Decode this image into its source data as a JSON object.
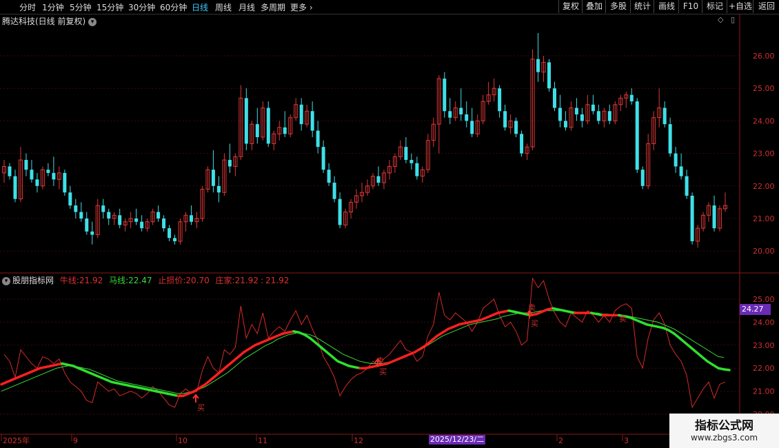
{
  "toolbar": {
    "timeframes": [
      "分时",
      "1分钟",
      "5分钟",
      "15分钟",
      "30分钟",
      "60分钟",
      "日线",
      "周线",
      "月线",
      "多周期",
      "更多"
    ],
    "active": "日线",
    "right_buttons": [
      "复权",
      "叠加",
      "多股",
      "统计",
      "画线",
      "F10",
      "标记",
      "+自选",
      "返回"
    ]
  },
  "chart_title": "腾达科技(日线 前复权)",
  "price_axis": [
    "26.00",
    "25.00",
    "24.00",
    "23.00",
    "22.00",
    "21.00",
    "20.00"
  ],
  "indicator": {
    "name": "股朋指标网",
    "niu_label": "牛线:",
    "niu_value": "21.92",
    "ma_label": "马线:",
    "ma_value": "22.47",
    "stop_label": "止损价:",
    "stop_value": "20.70",
    "zj_label": "庄家:",
    "zj_value": "21.92",
    "zj_value2": "21.92"
  },
  "ind_axis": [
    "25.00",
    "24.00",
    "23.00",
    "22.00",
    "21.00",
    "20.00"
  ],
  "current_badge": "24.27",
  "x_labels": [
    "2025年",
    "9",
    "10",
    "11",
    "12",
    "2",
    "3"
  ],
  "date_badge": "2025/12/23/二",
  "signals": {
    "buy": "买",
    "sell": "卖"
  },
  "watermark": {
    "title": "指标公式网",
    "url": "www.zbgs3.com"
  },
  "chart_data": {
    "type": "candlestick",
    "series": [
      {
        "name": "K线",
        "ohlc": [
          [
            22.4,
            22.8,
            22.1,
            22.6
          ],
          [
            22.6,
            22.7,
            22.2,
            22.3
          ],
          [
            22.3,
            22.5,
            21.5,
            21.6
          ],
          [
            21.6,
            23.2,
            21.5,
            22.8
          ],
          [
            22.8,
            23.0,
            22.3,
            22.5
          ],
          [
            22.5,
            22.8,
            22.1,
            22.2
          ],
          [
            22.2,
            22.4,
            21.8,
            22.0
          ],
          [
            22.0,
            22.6,
            21.9,
            22.5
          ],
          [
            22.5,
            22.7,
            22.3,
            22.4
          ],
          [
            22.4,
            22.9,
            22.0,
            22.2
          ],
          [
            22.2,
            22.6,
            21.9,
            22.4
          ],
          [
            22.4,
            22.5,
            21.7,
            21.8
          ],
          [
            21.8,
            22.0,
            21.3,
            21.4
          ],
          [
            21.4,
            21.6,
            21.0,
            21.2
          ],
          [
            21.2,
            21.5,
            20.9,
            21.0
          ],
          [
            21.0,
            21.2,
            20.5,
            20.6
          ],
          [
            20.6,
            20.9,
            20.2,
            20.5
          ],
          [
            20.5,
            21.6,
            20.4,
            21.4
          ],
          [
            21.4,
            21.6,
            21.0,
            21.2
          ],
          [
            21.2,
            21.3,
            20.8,
            21.0
          ],
          [
            21.0,
            21.2,
            20.8,
            21.1
          ],
          [
            21.1,
            21.3,
            20.7,
            20.8
          ],
          [
            20.8,
            21.0,
            20.6,
            20.9
          ],
          [
            20.9,
            21.2,
            20.7,
            21.0
          ],
          [
            21.0,
            21.3,
            20.8,
            20.9
          ],
          [
            20.9,
            21.1,
            20.6,
            20.7
          ],
          [
            20.7,
            21.0,
            20.6,
            20.9
          ],
          [
            20.9,
            21.3,
            20.8,
            21.2
          ],
          [
            21.2,
            21.4,
            20.9,
            21.0
          ],
          [
            21.0,
            21.1,
            20.6,
            20.7
          ],
          [
            20.7,
            20.8,
            20.3,
            20.4
          ],
          [
            20.4,
            20.5,
            20.2,
            20.3
          ],
          [
            20.3,
            21.0,
            20.2,
            20.9
          ],
          [
            20.9,
            21.2,
            20.6,
            21.1
          ],
          [
            21.1,
            21.4,
            20.8,
            20.9
          ],
          [
            20.9,
            21.2,
            20.7,
            21.0
          ],
          [
            21.0,
            22.0,
            20.9,
            21.9
          ],
          [
            21.9,
            22.6,
            21.8,
            22.5
          ],
          [
            22.5,
            23.1,
            21.8,
            22.0
          ],
          [
            22.0,
            22.3,
            21.5,
            21.8
          ],
          [
            21.8,
            23.0,
            21.7,
            22.8
          ],
          [
            22.8,
            23.3,
            22.4,
            22.6
          ],
          [
            22.6,
            23.0,
            22.3,
            22.9
          ],
          [
            22.9,
            25.1,
            22.8,
            24.7
          ],
          [
            24.7,
            25.0,
            23.1,
            23.3
          ],
          [
            23.3,
            24.0,
            23.1,
            23.9
          ],
          [
            23.9,
            24.4,
            23.3,
            23.5
          ],
          [
            23.5,
            24.6,
            23.4,
            24.4
          ],
          [
            24.4,
            24.6,
            23.2,
            23.3
          ],
          [
            23.3,
            23.7,
            23.1,
            23.6
          ],
          [
            23.6,
            24.0,
            23.4,
            23.8
          ],
          [
            23.8,
            24.3,
            23.5,
            23.6
          ],
          [
            23.6,
            24.2,
            23.5,
            24.1
          ],
          [
            24.1,
            24.7,
            24.0,
            24.5
          ],
          [
            24.5,
            24.7,
            23.7,
            23.9
          ],
          [
            23.9,
            24.5,
            23.8,
            24.3
          ],
          [
            24.3,
            24.6,
            23.5,
            23.7
          ],
          [
            23.7,
            24.0,
            23.0,
            23.2
          ],
          [
            23.2,
            23.4,
            22.4,
            22.5
          ],
          [
            22.5,
            22.7,
            22.0,
            22.1
          ],
          [
            22.1,
            22.3,
            21.5,
            21.6
          ],
          [
            21.6,
            21.8,
            20.7,
            20.8
          ],
          [
            20.8,
            21.3,
            20.7,
            21.2
          ],
          [
            21.2,
            21.6,
            21.0,
            21.5
          ],
          [
            21.5,
            21.9,
            21.3,
            21.7
          ],
          [
            21.7,
            22.1,
            21.5,
            21.8
          ],
          [
            21.8,
            22.2,
            21.7,
            22.0
          ],
          [
            22.0,
            22.4,
            21.9,
            22.3
          ],
          [
            22.3,
            22.6,
            22.0,
            22.1
          ],
          [
            22.1,
            22.5,
            21.9,
            22.4
          ],
          [
            22.4,
            22.8,
            22.2,
            22.6
          ],
          [
            22.6,
            23.0,
            22.4,
            22.9
          ],
          [
            22.9,
            23.4,
            22.8,
            23.2
          ],
          [
            23.2,
            23.5,
            22.7,
            22.8
          ],
          [
            22.8,
            23.0,
            22.5,
            22.7
          ],
          [
            22.7,
            22.9,
            22.2,
            22.3
          ],
          [
            22.3,
            22.6,
            22.1,
            22.5
          ],
          [
            22.5,
            23.6,
            22.4,
            23.4
          ],
          [
            23.4,
            24.1,
            23.2,
            23.9
          ],
          [
            23.9,
            25.4,
            23.0,
            25.3
          ],
          [
            25.3,
            25.5,
            24.1,
            24.3
          ],
          [
            24.3,
            24.7,
            23.9,
            24.1
          ],
          [
            24.1,
            24.6,
            24.0,
            24.4
          ],
          [
            24.4,
            25.0,
            24.0,
            24.2
          ],
          [
            24.2,
            24.6,
            23.8,
            24.0
          ],
          [
            24.0,
            24.4,
            23.5,
            23.6
          ],
          [
            23.6,
            24.2,
            23.5,
            24.0
          ],
          [
            24.0,
            24.8,
            23.9,
            24.6
          ],
          [
            24.6,
            25.2,
            24.5,
            24.8
          ],
          [
            24.8,
            25.3,
            24.6,
            25.0
          ],
          [
            25.0,
            25.1,
            24.1,
            24.3
          ],
          [
            24.3,
            24.5,
            23.7,
            23.8
          ],
          [
            23.8,
            24.2,
            23.6,
            24.0
          ],
          [
            24.0,
            24.1,
            23.5,
            23.6
          ],
          [
            23.6,
            23.7,
            22.9,
            23.0
          ],
          [
            23.0,
            23.3,
            22.8,
            23.2
          ],
          [
            23.2,
            26.2,
            23.1,
            25.9
          ],
          [
            25.9,
            26.7,
            25.2,
            25.5
          ],
          [
            25.5,
            26.0,
            25.2,
            25.8
          ],
          [
            25.8,
            25.9,
            24.9,
            25.0
          ],
          [
            25.0,
            25.2,
            24.3,
            24.4
          ],
          [
            24.4,
            24.8,
            23.8,
            24.0
          ],
          [
            24.0,
            24.3,
            23.7,
            23.8
          ],
          [
            23.8,
            24.6,
            23.7,
            24.4
          ],
          [
            24.4,
            24.7,
            24.0,
            24.2
          ],
          [
            24.2,
            24.4,
            23.8,
            24.0
          ],
          [
            24.0,
            24.8,
            23.9,
            24.5
          ],
          [
            24.5,
            24.8,
            24.2,
            24.3
          ],
          [
            24.3,
            24.5,
            23.9,
            24.0
          ],
          [
            24.0,
            24.4,
            23.8,
            24.3
          ],
          [
            24.3,
            24.5,
            23.9,
            24.0
          ],
          [
            24.0,
            24.6,
            23.9,
            24.5
          ],
          [
            24.5,
            24.8,
            24.3,
            24.7
          ],
          [
            24.7,
            24.9,
            24.4,
            24.8
          ],
          [
            24.8,
            25.0,
            24.5,
            24.6
          ],
          [
            24.6,
            24.7,
            22.4,
            22.5
          ],
          [
            22.5,
            22.6,
            21.9,
            22.0
          ],
          [
            22.0,
            23.6,
            21.9,
            23.3
          ],
          [
            23.3,
            24.3,
            23.1,
            24.1
          ],
          [
            24.1,
            25.0,
            23.8,
            24.4
          ],
          [
            24.4,
            24.6,
            23.8,
            23.9
          ],
          [
            23.9,
            24.1,
            22.9,
            23.0
          ],
          [
            23.0,
            23.2,
            22.4,
            22.6
          ],
          [
            22.6,
            23.0,
            22.2,
            22.3
          ],
          [
            22.3,
            22.5,
            21.6,
            21.7
          ],
          [
            21.7,
            21.8,
            20.2,
            20.3
          ],
          [
            20.3,
            20.8,
            20.1,
            20.7
          ],
          [
            20.7,
            21.2,
            20.6,
            21.1
          ],
          [
            21.1,
            21.5,
            20.9,
            21.4
          ],
          [
            21.4,
            21.7,
            20.6,
            20.7
          ],
          [
            20.7,
            21.4,
            20.6,
            21.3
          ],
          [
            21.3,
            21.8,
            21.2,
            21.4
          ]
        ]
      },
      {
        "name": "牛线",
        "values": [
          21.3,
          21.4,
          21.5,
          21.6,
          21.7,
          21.8,
          21.9,
          22.0,
          22.05,
          22.1,
          22.15,
          22.2,
          22.15,
          22.1,
          22.0,
          21.9,
          21.8,
          21.7,
          21.6,
          21.5,
          21.4,
          21.35,
          21.3,
          21.25,
          21.2,
          21.15,
          21.1,
          21.05,
          21.0,
          20.95,
          20.9,
          20.85,
          20.8,
          20.8,
          20.9,
          21.0,
          21.15,
          21.3,
          21.5,
          21.7,
          21.9,
          22.1,
          22.3,
          22.5,
          22.7,
          22.85,
          23.0,
          23.1,
          23.2,
          23.3,
          23.4,
          23.5,
          23.55,
          23.6,
          23.55,
          23.45,
          23.3,
          23.1,
          22.9,
          22.7,
          22.5,
          22.3,
          22.2,
          22.1,
          22.05,
          22.0,
          22.0,
          22.05,
          22.1,
          22.15,
          22.2,
          22.3,
          22.4,
          22.5,
          22.6,
          22.7,
          22.85,
          23.0,
          23.2,
          23.4,
          23.55,
          23.7,
          23.8,
          23.9,
          23.95,
          24.0,
          24.05,
          24.1,
          24.2,
          24.3,
          24.4,
          24.45,
          24.5,
          24.45,
          24.4,
          24.35,
          24.3,
          24.35,
          24.45,
          24.55,
          24.6,
          24.55,
          24.5,
          24.45,
          24.4,
          24.4,
          24.4,
          24.4,
          24.35,
          24.3,
          24.3,
          24.3,
          24.3,
          24.25,
          24.2,
          24.1,
          24.0,
          23.9,
          23.85,
          23.8,
          23.75,
          23.65,
          23.5,
          23.3,
          23.1,
          22.9,
          22.7,
          22.5,
          22.3,
          22.15,
          22.0,
          21.95,
          21.92
        ]
      },
      {
        "name": "马线",
        "values": [
          21.0,
          21.1,
          21.2,
          21.3,
          21.4,
          21.5,
          21.6,
          21.7,
          21.8,
          21.9,
          22.0,
          22.05,
          22.1,
          22.1,
          22.05,
          22.0,
          21.95,
          21.85,
          21.75,
          21.65,
          21.55,
          21.45,
          21.4,
          21.35,
          21.3,
          21.25,
          21.2,
          21.15,
          21.1,
          21.05,
          21.0,
          20.95,
          20.9,
          20.9,
          20.95,
          21.0,
          21.1,
          21.2,
          21.35,
          21.5,
          21.65,
          21.8,
          22.0,
          22.2,
          22.4,
          22.55,
          22.7,
          22.85,
          23.0,
          23.1,
          23.25,
          23.35,
          23.45,
          23.5,
          23.55,
          23.5,
          23.45,
          23.35,
          23.2,
          23.05,
          22.9,
          22.75,
          22.6,
          22.5,
          22.4,
          22.3,
          22.25,
          22.2,
          22.2,
          22.2,
          22.25,
          22.3,
          22.4,
          22.5,
          22.6,
          22.7,
          22.8,
          22.95,
          23.1,
          23.25,
          23.4,
          23.5,
          23.6,
          23.7,
          23.8,
          23.9,
          23.95,
          24.0,
          24.05,
          24.1,
          24.15,
          24.25,
          24.3,
          24.35,
          24.4,
          24.4,
          24.4,
          24.45,
          24.5,
          24.5,
          24.5,
          24.5,
          24.5,
          24.45,
          24.45,
          24.4,
          24.4,
          24.4,
          24.4,
          24.35,
          24.35,
          24.3,
          24.3,
          24.3,
          24.25,
          24.2,
          24.15,
          24.1,
          24.05,
          24.0,
          23.9,
          23.8,
          23.7,
          23.55,
          23.4,
          23.25,
          23.1,
          22.95,
          22.8,
          22.65,
          22.5,
          22.47
        ]
      }
    ]
  }
}
